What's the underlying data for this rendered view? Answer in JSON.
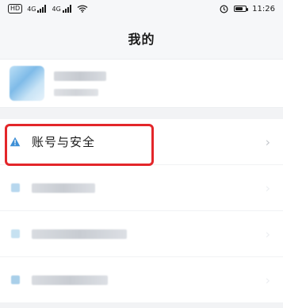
{
  "status_bar": {
    "hd_badge": "HD",
    "signal_1": "4G",
    "signal_2": "4G",
    "time": "11:26"
  },
  "header": {
    "title": "我的"
  },
  "menu": {
    "account_security": {
      "label": "账号与安全"
    }
  },
  "colors": {
    "highlight": "#e3262a",
    "warning_icon": "#3d8fd6"
  }
}
